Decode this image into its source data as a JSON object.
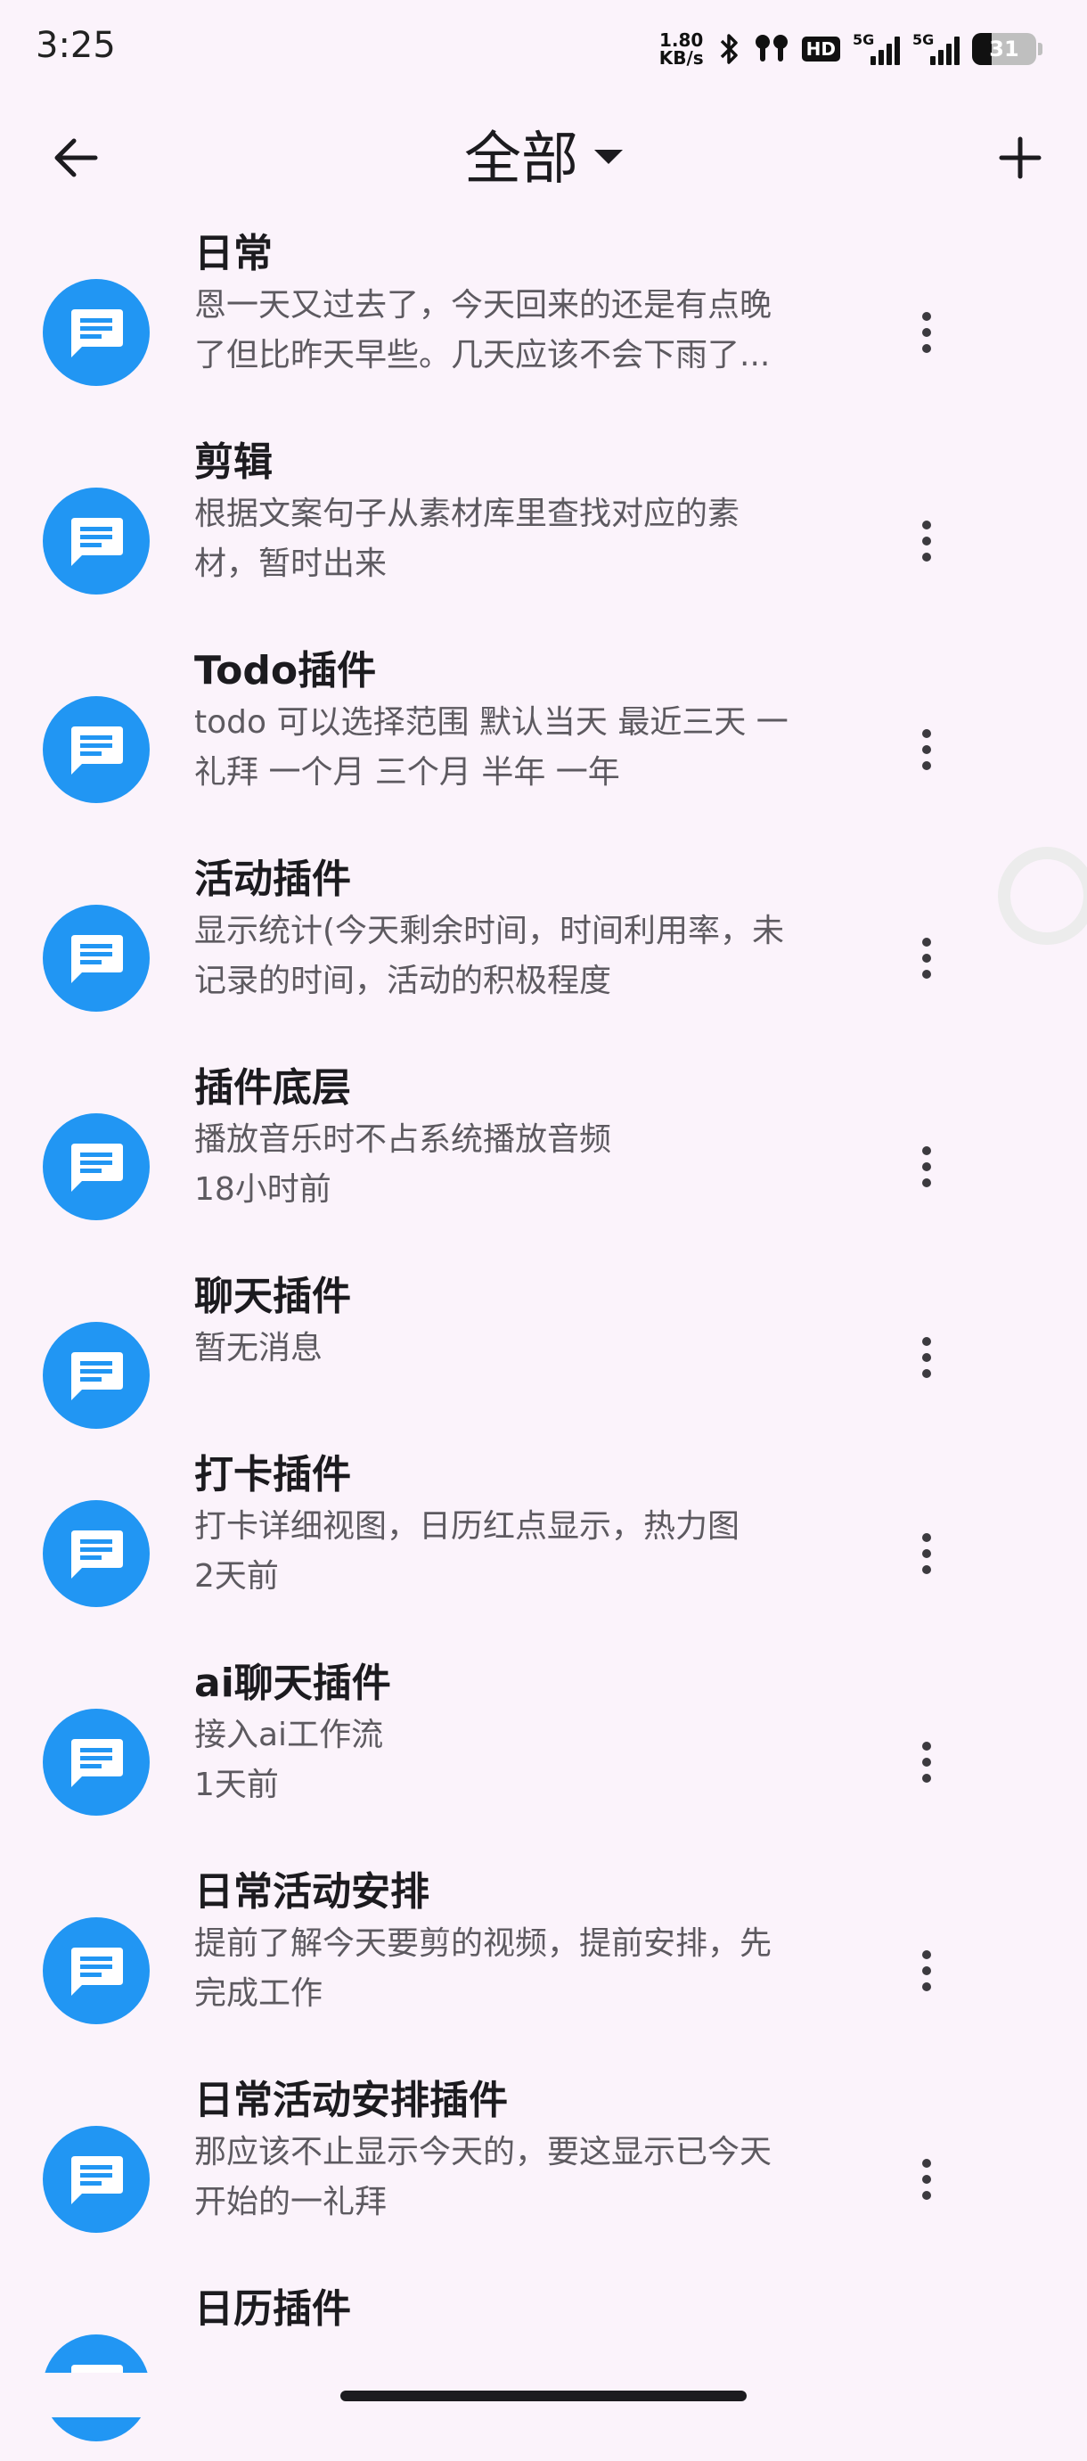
{
  "status_bar": {
    "time": "3:25",
    "net_speed_value": "1.80",
    "net_speed_unit": "KB/s",
    "hd_label": "HD",
    "signal1_label": "5G",
    "signal2_label": "5G",
    "battery": "31",
    "battery_level": 0.31
  },
  "app_bar": {
    "title": "全部"
  },
  "items": [
    {
      "title": "日常",
      "line1": "恩一天又过去了，今天回来的还是有点晚",
      "line2": "了但比昨天早些。几天应该不会下雨了..."
    },
    {
      "title": "剪辑",
      "line1": "根据文案句子从素材库里查找对应的素",
      "line2": "材，暂时出来"
    },
    {
      "title": "Todo插件",
      "line1": "todo 可以选择范围 默认当天 最近三天 一",
      "line2": "礼拜 一个月 三个月 半年 一年"
    },
    {
      "title": "活动插件",
      "line1": "显示统计(今天剩余时间，时间利用率，未",
      "line2": "记录的时间，活动的积极程度"
    },
    {
      "title": "插件底层",
      "line1": "播放音乐时不占系统播放音频",
      "line2": "18小时前"
    },
    {
      "title": "聊天插件",
      "line1": "暂无消息",
      "line2": ""
    },
    {
      "title": "打卡插件",
      "line1": "打卡详细视图，日历红点显示，热力图",
      "line2": "2天前"
    },
    {
      "title": "ai聊天插件",
      "line1": "接入ai工作流",
      "line2": "1天前"
    },
    {
      "title": "日常活动安排",
      "line1": "提前了解今天要剪的视频，提前安排，先",
      "line2": "完成工作"
    },
    {
      "title": "日常活动安排插件",
      "line1": "那应该不止显示今天的，要这显示已今天",
      "line2": "开始的一礼拜"
    },
    {
      "title": "日历插件",
      "line1": "",
      "line2": ""
    }
  ],
  "colors": {
    "background": "#fbf3fb",
    "avatar": "#2196f3"
  },
  "icons": {
    "back": "arrow-left-icon",
    "dropdown": "caret-down-icon",
    "add": "plus-icon",
    "item": "message-text-icon",
    "menu": "more-vert-icon"
  }
}
